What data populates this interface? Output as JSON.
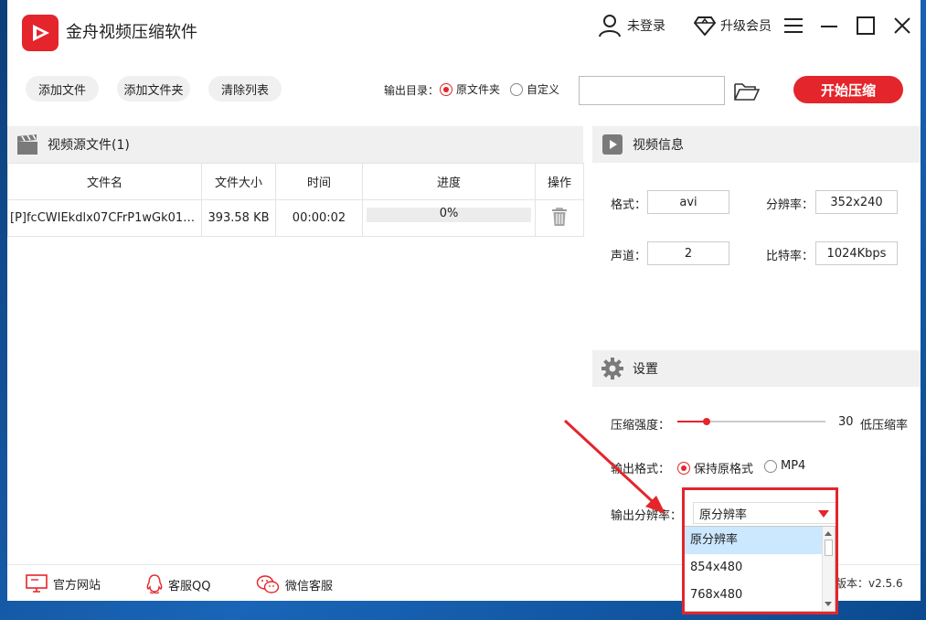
{
  "app": {
    "title": "金舟视频压缩软件",
    "user_label": "未登录",
    "vip_label": "升级会员"
  },
  "toolbar": {
    "add_file": "添加文件",
    "add_folder": "添加文件夹",
    "clear_list": "清除列表",
    "output_dir_label": "输出目录：",
    "opt_original": "原文件夹",
    "opt_custom": "自定义",
    "output_dir_value": "",
    "start_label": "开始压缩"
  },
  "source_panel": {
    "title": "视频源文件(1)",
    "columns": [
      "文件名",
      "文件大小",
      "时间",
      "进度",
      "操作"
    ],
    "rows": [
      {
        "name": "[P]fcCWIEkdlx07CFrP1wGk010...",
        "size": "393.58 KB",
        "time": "00:00:02",
        "progress_text": "0%",
        "progress": 0
      }
    ]
  },
  "info_panel": {
    "title": "视频信息",
    "format_label": "格式：",
    "format_value": "avi",
    "resolution_label": "分辨率：",
    "resolution_value": "352x240",
    "channels_label": "声道：",
    "channels_value": "2",
    "bitrate_label": "比特率：",
    "bitrate_value": "1024Kbps"
  },
  "settings_panel": {
    "title": "设置",
    "strength_label": "压缩强度：",
    "strength_value": "30",
    "strength_hint": "低压缩率",
    "strength_level": 0.2,
    "format_label": "输出格式：",
    "format_opt_keep": "保持原格式",
    "format_opt_mp4": "MP4",
    "resolution_label": "输出分辨率：",
    "resolution_selected": "原分辨率",
    "resolution_options": [
      "原分辨率",
      "854x480",
      "768x480"
    ]
  },
  "footer": {
    "website": "官方网站",
    "qq": "客服QQ",
    "wechat": "微信客服",
    "version": "版本：v2.5.6"
  },
  "colors": {
    "accent": "#e4252b",
    "panel_header": "#f0f0f0",
    "selected_item": "#cce8ff"
  }
}
